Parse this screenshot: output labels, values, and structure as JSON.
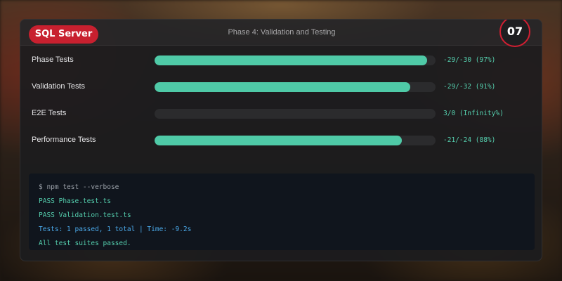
{
  "header": {
    "badge_label": "SQL Server",
    "title": "Phase 4: Validation and Testing",
    "step_number": "07"
  },
  "colors": {
    "accent_red": "#c8202f",
    "progress_green": "#4fcaa7",
    "terminal_green": "#55cfae",
    "terminal_blue": "#4aa8e8"
  },
  "tests": [
    {
      "label": "Phase Tests",
      "value": "-29/-30 (97%)",
      "progress": 0.97
    },
    {
      "label": "Validation Tests",
      "value": "-29/-32 (91%)",
      "progress": 0.91
    },
    {
      "label": "E2E Tests",
      "value": "3/0 (Infinity%)",
      "progress": 0
    },
    {
      "label": "Performance Tests",
      "value": "-21/-24 (88%)",
      "progress": 0.88
    }
  ],
  "terminal": {
    "lines": [
      {
        "text": "$ npm test --verbose",
        "kind": "cmd"
      },
      {
        "text": "PASS Phase.test.ts",
        "kind": "pass"
      },
      {
        "text": "PASS Validation.test.ts",
        "kind": "pass"
      },
      {
        "text": "Tests: 1 passed, 1 total | Time: -9.2s",
        "kind": "info"
      },
      {
        "text": "All test suites passed.",
        "kind": "pass"
      }
    ]
  }
}
